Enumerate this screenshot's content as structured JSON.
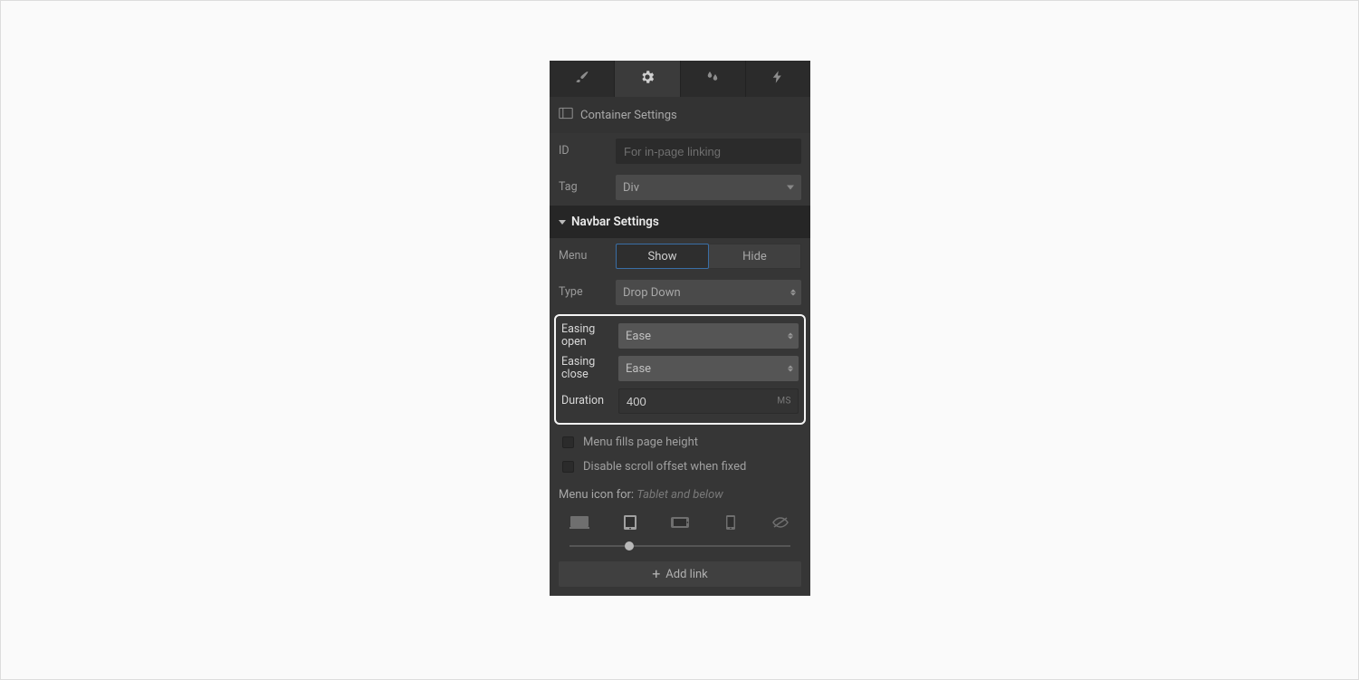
{
  "sections": {
    "container": {
      "title": "Container Settings",
      "id_label": "ID",
      "id_placeholder": "For in-page linking",
      "id_value": "",
      "tag_label": "Tag",
      "tag_value": "Div"
    },
    "navbar": {
      "title": "Navbar Settings",
      "menu_label": "Menu",
      "show_label": "Show",
      "hide_label": "Hide",
      "type_label": "Type",
      "type_value": "Drop Down",
      "easing_open_label": "Easing open",
      "easing_open_value": "Ease",
      "easing_close_label": "Easing close",
      "easing_close_value": "Ease",
      "duration_label": "Duration",
      "duration_value": "400",
      "duration_unit": "MS",
      "fills_label": "Menu fills page height",
      "disable_scroll_label": "Disable scroll offset when fixed",
      "menuicon_label": "Menu icon for:",
      "menuicon_value": "Tablet and below",
      "addlink_label": "Add link"
    }
  }
}
